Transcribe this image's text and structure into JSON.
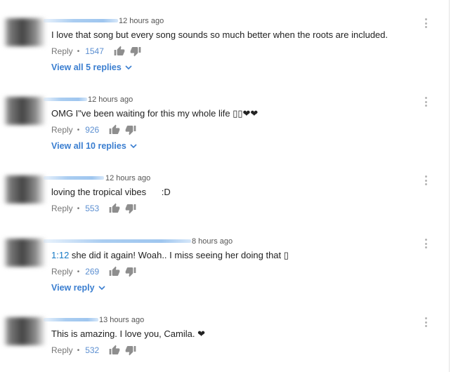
{
  "comments": [
    {
      "time": "12 hours ago",
      "text": "I love that song but every song sounds so much better when the roots are included.",
      "reply_label": "Reply",
      "likes": "1547",
      "view_replies": "View all 5 replies"
    },
    {
      "time": "12 hours ago",
      "text": "OMG I\"ve been waiting for this my whole life ▯▯❤❤",
      "reply_label": "Reply",
      "likes": "926",
      "view_replies": "View all 10 replies"
    },
    {
      "time": "12 hours ago",
      "text": "loving the tropical vibes      :D",
      "reply_label": "Reply",
      "likes": "553"
    },
    {
      "time": "8 hours ago",
      "timestamp_link": "1:12",
      "text": " she did it again! Woah.. I miss seeing her doing that ▯",
      "reply_label": "Reply",
      "likes": "269",
      "view_replies": "View reply"
    },
    {
      "time": "13 hours ago",
      "text": "This is amazing. I love you, Camila. ❤",
      "reply_label": "Reply",
      "likes": "532"
    }
  ],
  "icons": {
    "like": "thumbs-up-icon",
    "dislike": "thumbs-down-icon",
    "more": "more-vert-icon",
    "expand": "chevron-down-icon"
  },
  "colors": {
    "link_blue": "#3a7ed0",
    "like_count": "#5c8fd1",
    "meta_gray": "#767676"
  }
}
